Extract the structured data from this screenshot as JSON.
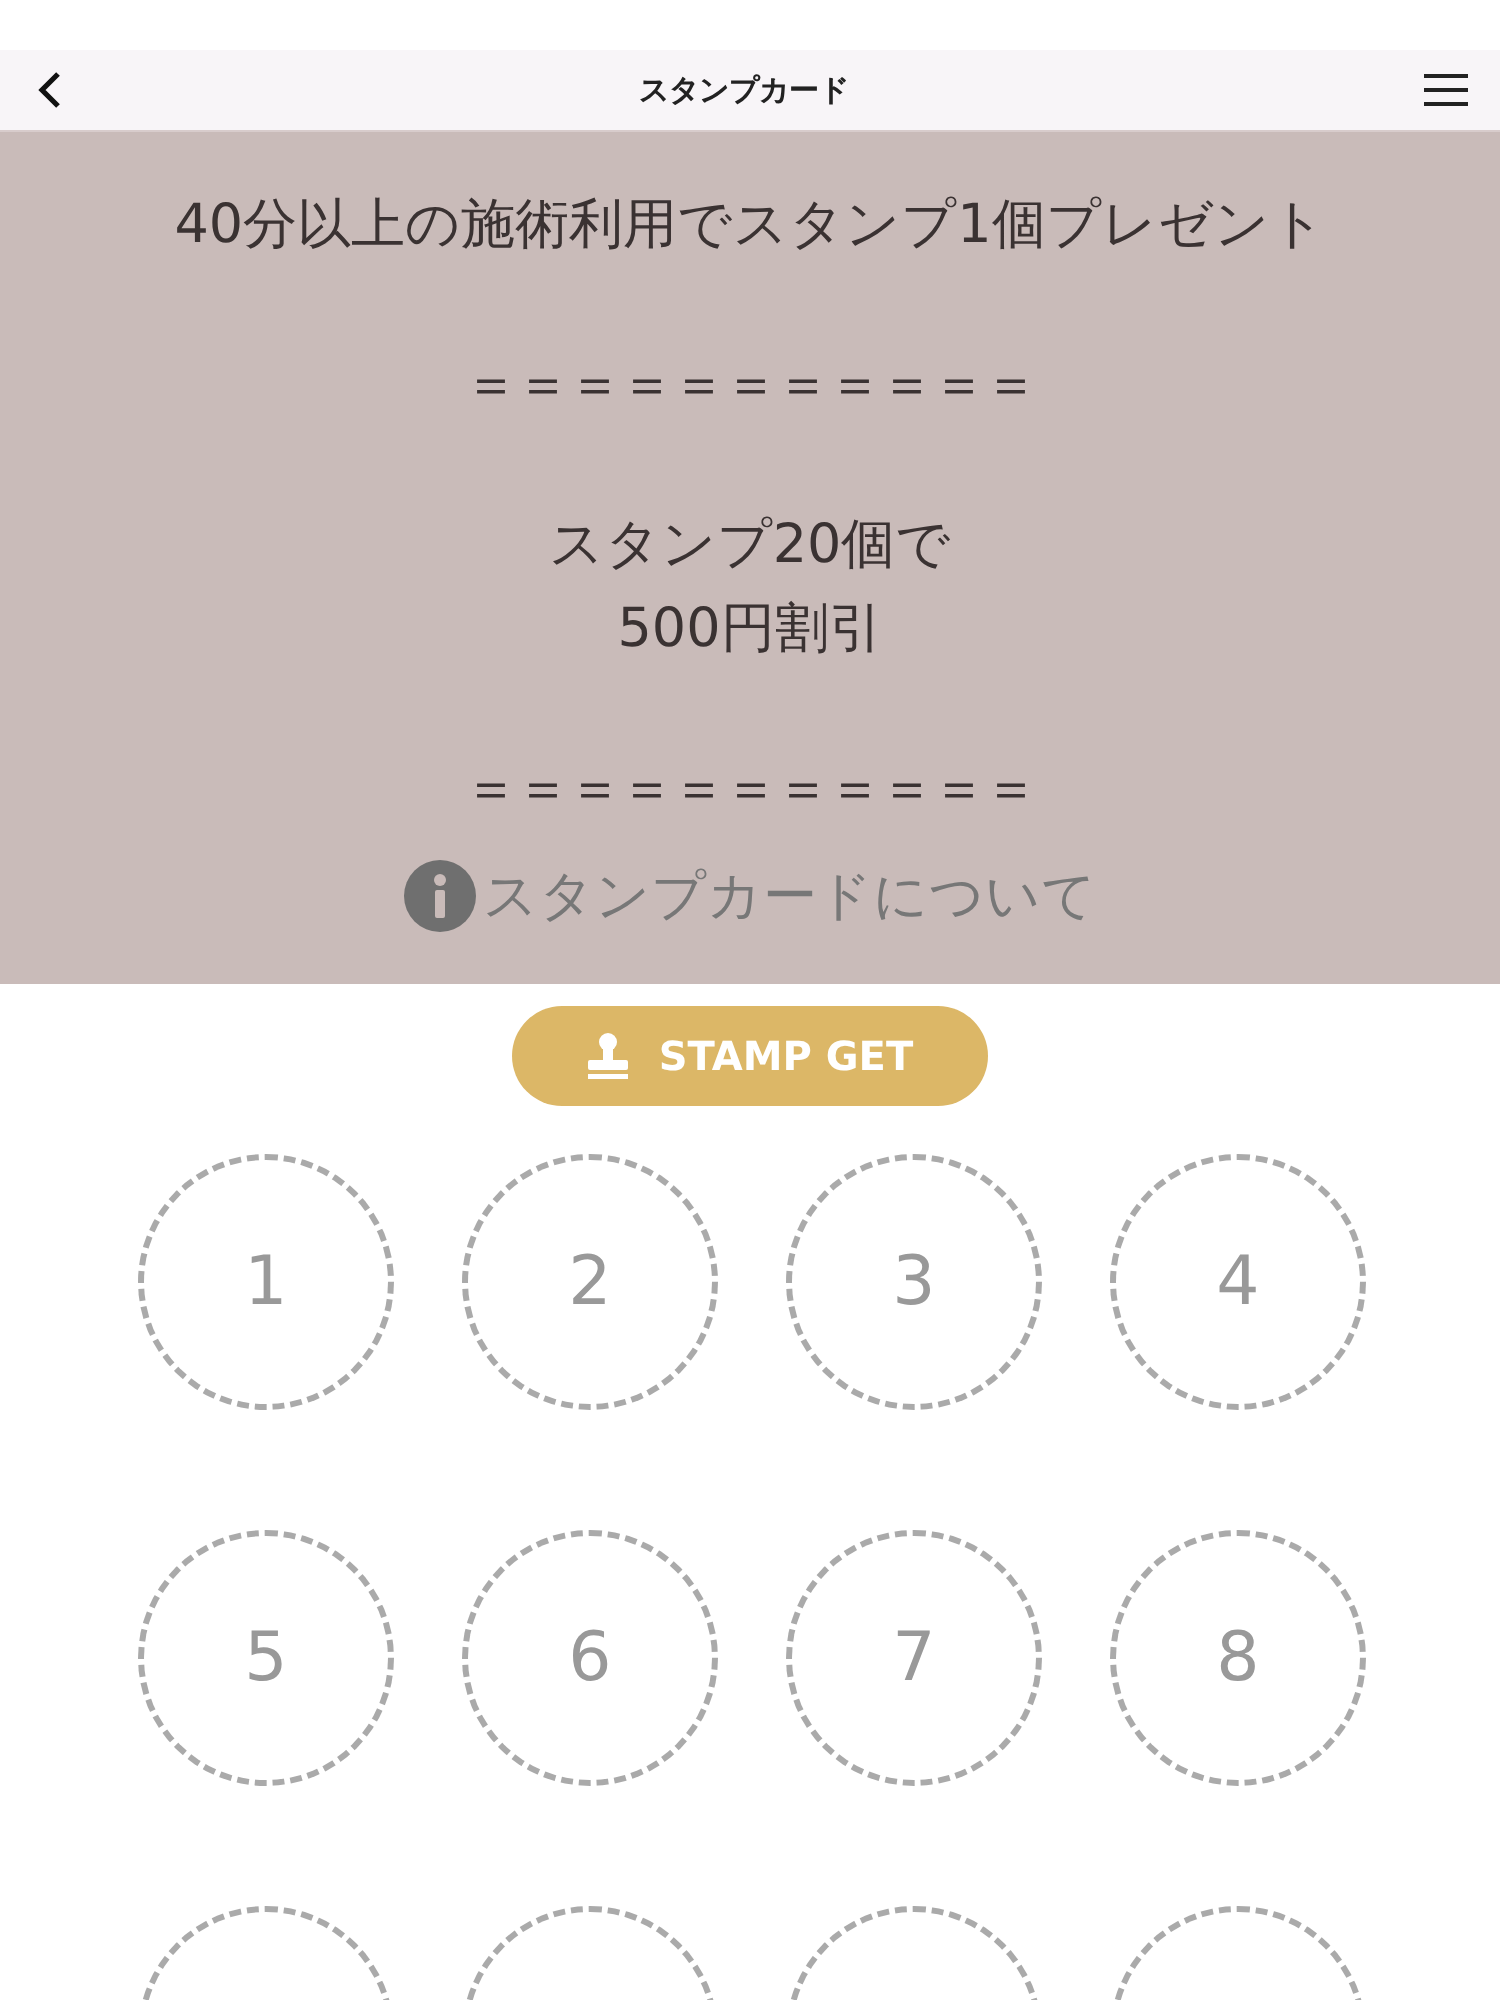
{
  "header": {
    "title": "スタンプカード"
  },
  "banner": {
    "lines": [
      {
        "kind": "text",
        "text": "40分以上の施術利用でスタンプ1個プレゼント"
      },
      {
        "kind": "rule",
        "text": "＝＝＝＝＝＝＝＝＝＝＝"
      },
      {
        "kind": "text",
        "text": "スタンプ20個で\n500円割引"
      },
      {
        "kind": "rule",
        "text": "＝＝＝＝＝＝＝＝＝＝＝"
      }
    ],
    "info_link": "スタンプカードについて"
  },
  "stamp_button": "STAMP GET",
  "slots": [
    {
      "kind": "numbered",
      "label": "1"
    },
    {
      "kind": "numbered",
      "label": "2"
    },
    {
      "kind": "numbered",
      "label": "3"
    },
    {
      "kind": "numbered",
      "label": "4"
    },
    {
      "kind": "numbered",
      "label": "5"
    },
    {
      "kind": "numbered",
      "label": "6"
    },
    {
      "kind": "numbered",
      "label": "7"
    },
    {
      "kind": "numbered",
      "label": "8"
    },
    {
      "kind": "blank"
    },
    {
      "kind": "blank"
    },
    {
      "kind": "blank"
    },
    {
      "kind": "blank"
    }
  ]
}
